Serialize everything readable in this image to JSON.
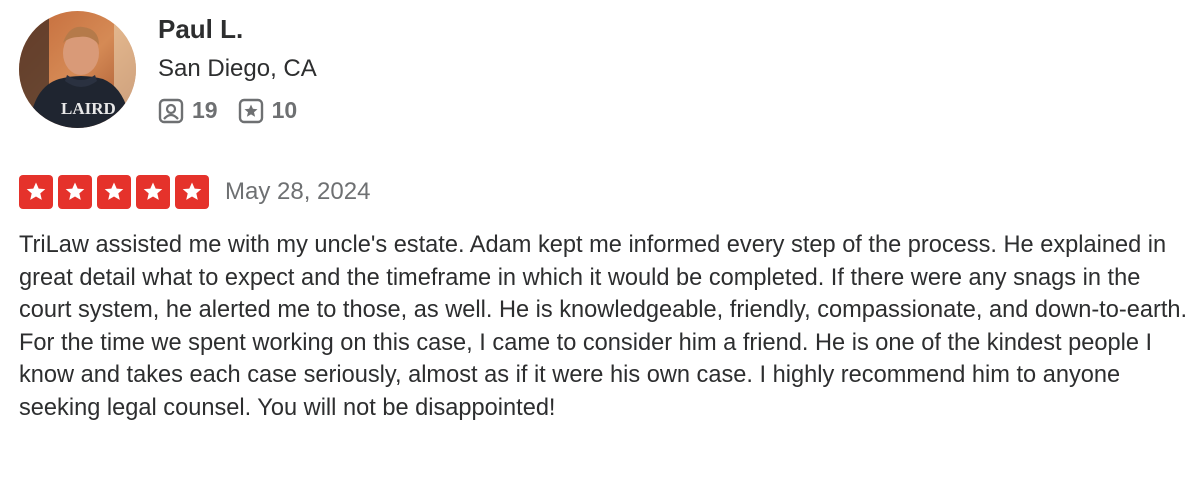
{
  "reviewer": {
    "name": "Paul L.",
    "location": "San Diego, CA",
    "stats": {
      "reviews_count": "19",
      "photos_count": "10",
      "reviews_icon": "friends-icon",
      "photos_icon": "star-badge-icon"
    },
    "avatar_shirt_text": "LAIRD"
  },
  "review": {
    "rating": 5,
    "max_rating": 5,
    "date": "May 28, 2024",
    "text": "TriLaw assisted me with my uncle's estate. Adam kept me informed every step of the process. He explained in great detail what to expect and the timeframe in which it would be completed. If there were any snags in the court system, he alerted me to those, as well. He is knowledgeable, friendly, compassionate, and down-to-earth. For the time we spent working on this case, I came to consider him a friend. He is one of the kindest people I know and takes each case seriously, almost as if it were his own case. I highly recommend him to anyone seeking legal counsel. You will not be disappointed!"
  },
  "colors": {
    "star_fill": "#e5322b",
    "text_primary": "#2d2e2f",
    "text_secondary": "#6e7072"
  }
}
